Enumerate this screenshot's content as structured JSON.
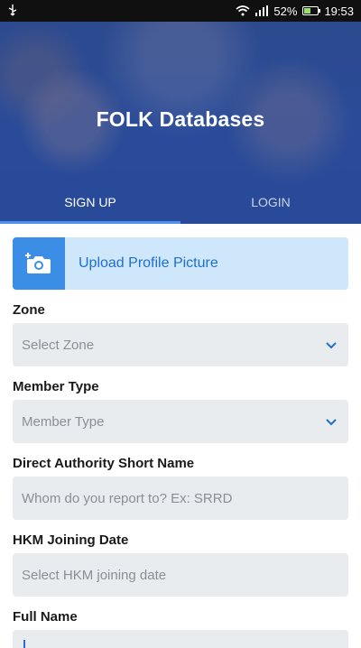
{
  "status": {
    "battery": "52%",
    "time": "19:53",
    "battery_level": 0.52
  },
  "header": {
    "title": "FOLK Databases",
    "tabs": [
      "SIGN UP",
      "LOGIN"
    ],
    "active_tab": 0
  },
  "upload": {
    "label": "Upload Profile Picture"
  },
  "form": {
    "zone": {
      "label": "Zone",
      "placeholder": "Select Zone"
    },
    "member_type": {
      "label": "Member Type",
      "placeholder": "Member Type"
    },
    "authority": {
      "label": "Direct Authority Short Name",
      "placeholder": "Whom do you report to? Ex: SRRD"
    },
    "joining": {
      "label": "HKM Joining Date",
      "placeholder": "Select HKM joining date"
    },
    "full_name": {
      "label": "Full Name",
      "value": ""
    }
  },
  "colors": {
    "accent": "#3a8ee6",
    "link": "#1e6fd0",
    "field_bg": "#e9ecef",
    "upload_bg": "#cfe7fb"
  }
}
